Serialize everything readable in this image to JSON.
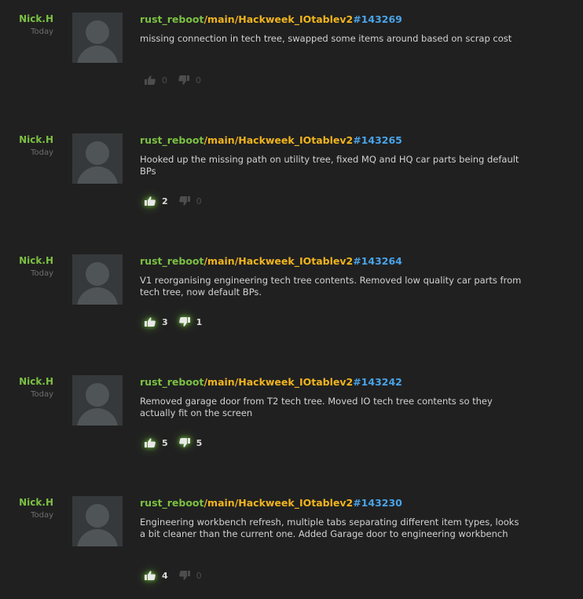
{
  "commits": [
    {
      "author": "Nick.H",
      "time": "Today",
      "repo": "rust_reboot",
      "branch": "/main/Hackweek_IOtablev2",
      "changelist": "#143269",
      "message": "missing connection in tech tree, swapped some items around based on scrap cost",
      "upvotes": "0",
      "downvotes": "0"
    },
    {
      "author": "Nick.H",
      "time": "Today",
      "repo": "rust_reboot",
      "branch": "/main/Hackweek_IOtablev2",
      "changelist": "#143265",
      "message": "Hooked up the missing path on utility tree, fixed MQ and HQ car parts being default BPs",
      "upvotes": "2",
      "downvotes": "0"
    },
    {
      "author": "Nick.H",
      "time": "Today",
      "repo": "rust_reboot",
      "branch": "/main/Hackweek_IOtablev2",
      "changelist": "#143264",
      "message": "V1 reorganising engineering tech tree contents. Removed low quality car parts from tech tree, now default BPs.",
      "upvotes": "3",
      "downvotes": "1"
    },
    {
      "author": "Nick.H",
      "time": "Today",
      "repo": "rust_reboot",
      "branch": "/main/Hackweek_IOtablev2",
      "changelist": "#143242",
      "message": "Removed garage door from T2 tech tree. Moved IO tech tree contents so they actually fit on the screen",
      "upvotes": "5",
      "downvotes": "5"
    },
    {
      "author": "Nick.H",
      "time": "Today",
      "repo": "rust_reboot",
      "branch": "/main/Hackweek_IOtablev2",
      "changelist": "#143230",
      "message": "Engineering workbench refresh, multiple tabs separating different item types, looks a bit cleaner than the current one. Added Garage door to engineering workbench",
      "upvotes": "4",
      "downvotes": "0"
    }
  ],
  "colors": {
    "background": "#202020",
    "author": "#7bc043",
    "repo": "#7bc043",
    "branch": "#f0b41e",
    "changelist": "#4aa3e8",
    "message": "#d2d2d2",
    "vote_inactive": "#4d4d4d",
    "vote_active_glow": "#78d23c"
  },
  "icons": {
    "upvote": "thumbs-up-icon",
    "downvote": "thumbs-down-icon",
    "avatar": "default-user-avatar"
  }
}
